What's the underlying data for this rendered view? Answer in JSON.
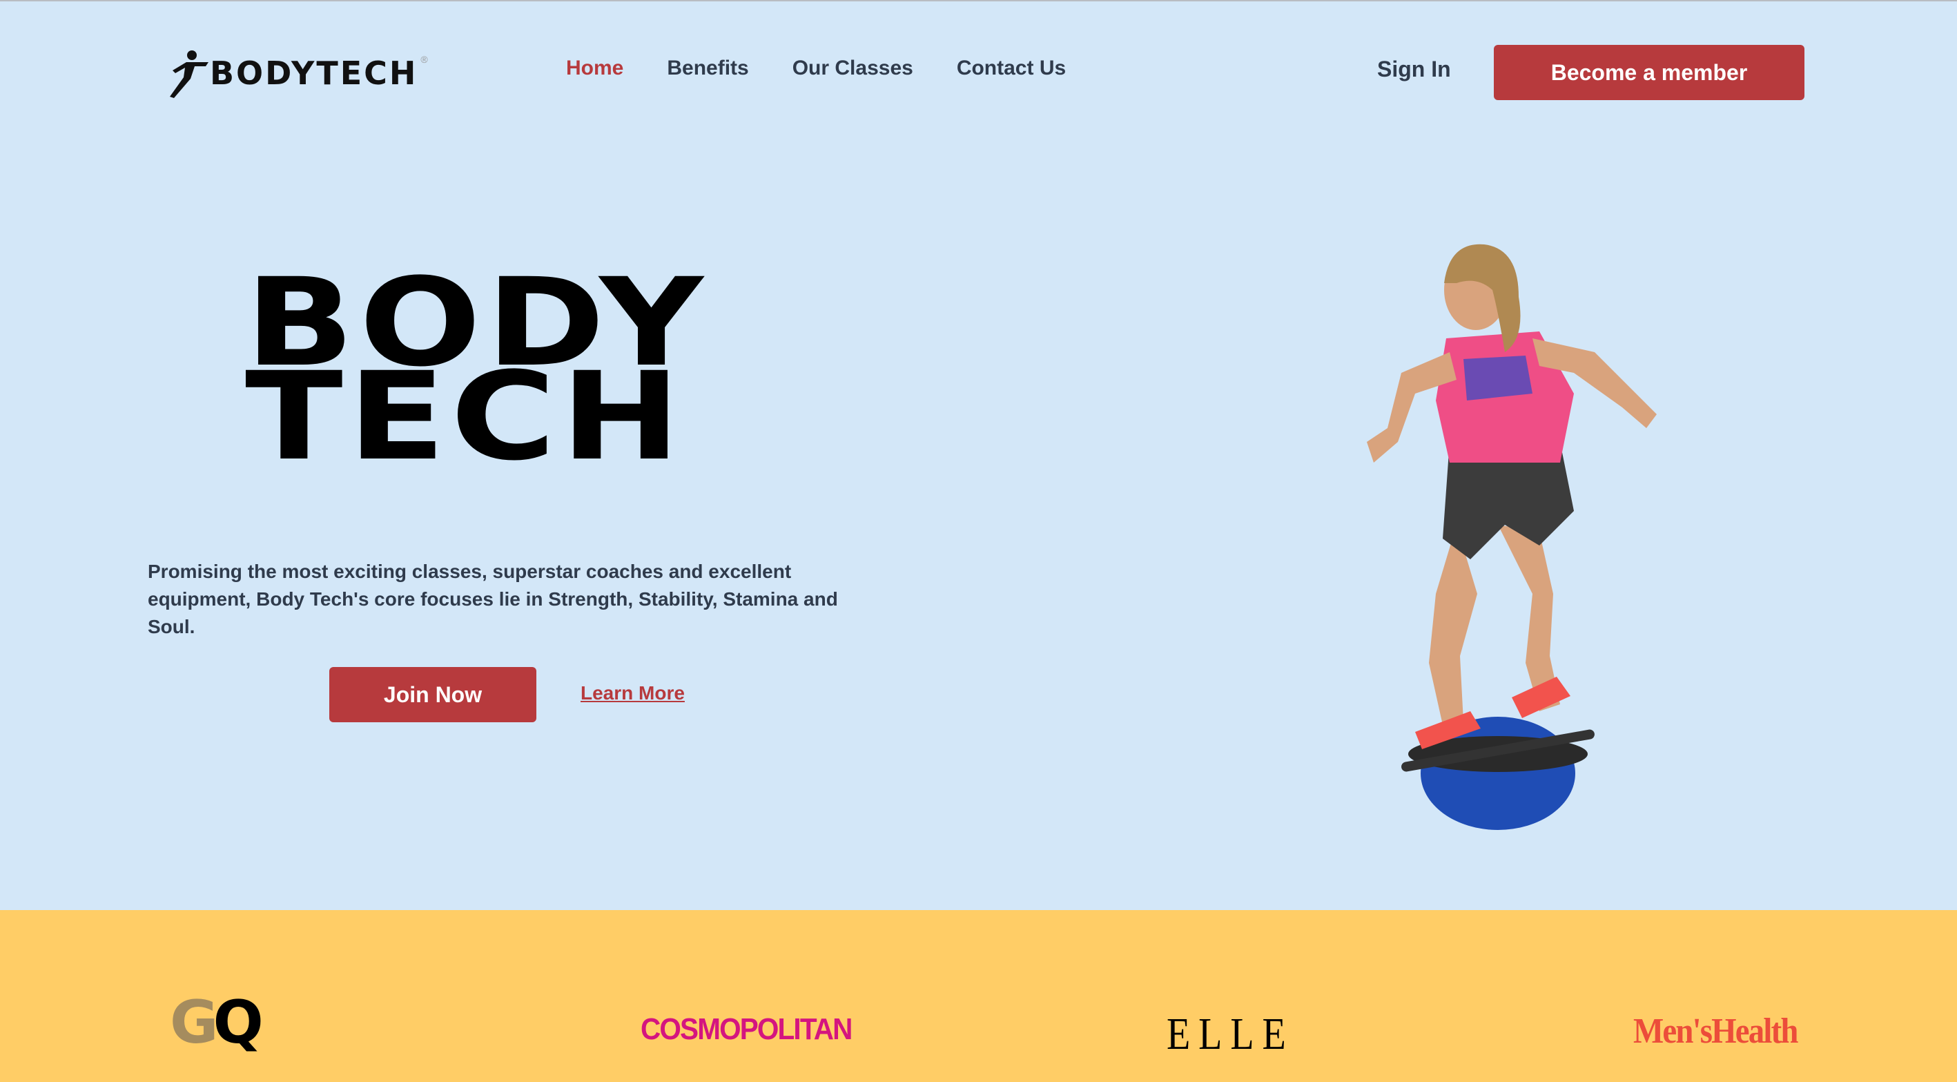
{
  "brand": {
    "logo_text": "BODYTECH",
    "logo_mark": "®"
  },
  "nav": {
    "items": [
      {
        "label": "Home",
        "active": true
      },
      {
        "label": "Benefits",
        "active": false
      },
      {
        "label": "Our Classes",
        "active": false
      },
      {
        "label": "Contact Us",
        "active": false
      }
    ],
    "sign_in": "Sign In",
    "cta": "Become a member"
  },
  "hero": {
    "title_line1": "BODY",
    "title_line2": "TECH",
    "description": "Promising the most exciting classes, superstar coaches and excellent equipment, Body Tech's core focuses lie in Strength, Stability, Stamina and Soul.",
    "primary_button": "Join Now",
    "secondary_link": "Learn More"
  },
  "press": {
    "logos": [
      {
        "name": "GQ",
        "part1": "G",
        "part2": "Q"
      },
      {
        "name": "COSMOPOLITAN"
      },
      {
        "name": "ELLE"
      },
      {
        "name": "Men'sHealth"
      }
    ]
  },
  "colors": {
    "hero_bg": "#d3e7f8",
    "accent": "#b73a3d",
    "band_bg": "#ffcd66",
    "nav_text": "#2f3b4c"
  }
}
